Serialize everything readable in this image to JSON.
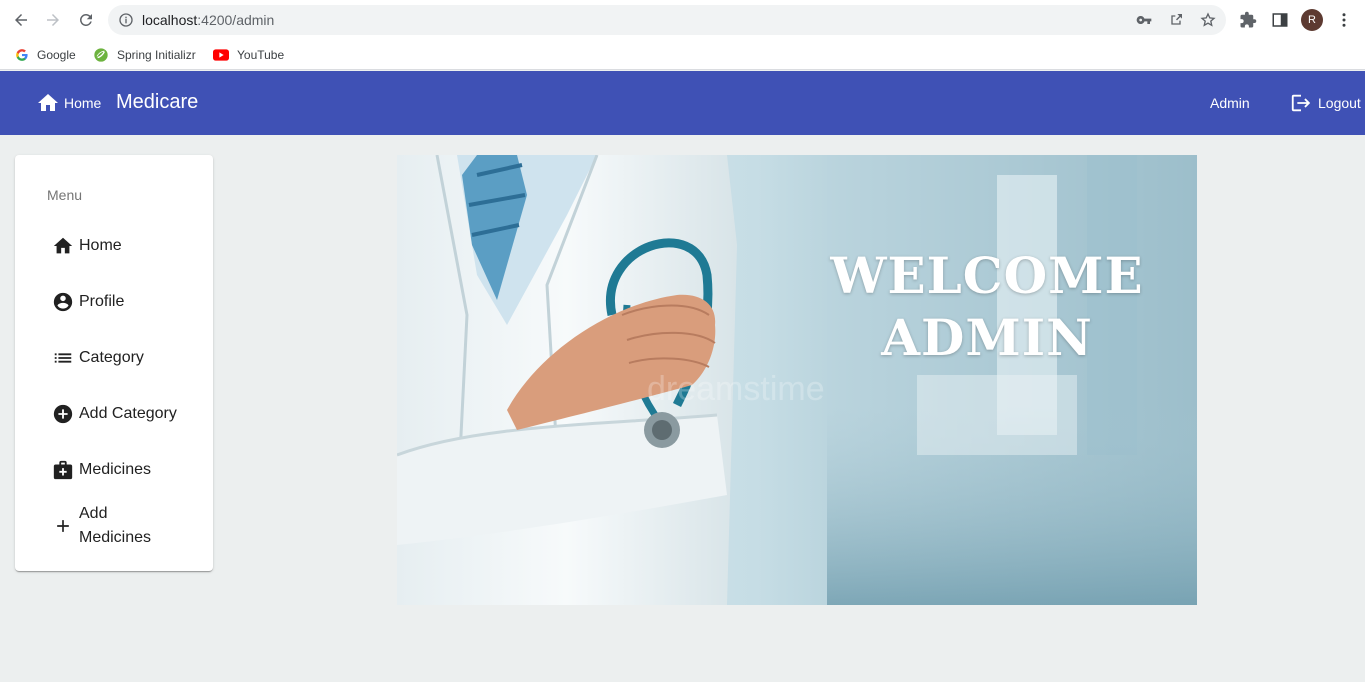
{
  "browser": {
    "url_host": "localhost",
    "url_rest": ":4200/admin",
    "profile_initial": "R",
    "bookmarks": [
      {
        "label": "Google",
        "icon": "google-icon"
      },
      {
        "label": "Spring Initializr",
        "icon": "spring-icon"
      },
      {
        "label": "YouTube",
        "icon": "youtube-icon"
      }
    ]
  },
  "toolbar": {
    "home_label": "Home",
    "brand": "Medicare",
    "admin_label": "Admin",
    "logout_label": "Logout",
    "color": "#3f51b5"
  },
  "menu": {
    "title": "Menu",
    "items": [
      {
        "label": "Home",
        "icon": "home-icon"
      },
      {
        "label": "Profile",
        "icon": "account-circle-icon"
      },
      {
        "label": "Category",
        "icon": "list-icon"
      },
      {
        "label": "Add Category",
        "icon": "add-circle-icon"
      },
      {
        "label": "Medicines",
        "icon": "medical-bag-icon"
      },
      {
        "label": "Add Medicines",
        "icon": "plus-icon"
      }
    ]
  },
  "banner": {
    "line1": "WELCOME",
    "line2": "ADMIN"
  }
}
